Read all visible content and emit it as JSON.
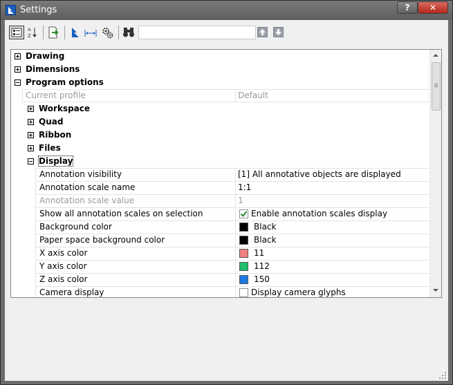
{
  "window": {
    "title": "Settings",
    "help_label": "?",
    "close_label": "✕"
  },
  "toolbar": {
    "items": [
      {
        "name": "categorized-view",
        "icon": "categorized-view-icon"
      },
      {
        "name": "alphabetical-view",
        "icon": "sort-az-icon"
      },
      {
        "name": "export",
        "icon": "export-icon"
      },
      {
        "name": "drawing-settings",
        "icon": "bricscad-icon"
      },
      {
        "name": "dimension-settings",
        "icon": "dimension-icon"
      },
      {
        "name": "program-options",
        "icon": "gears-icon"
      },
      {
        "name": "find",
        "icon": "binoculars-icon"
      }
    ],
    "search": {
      "value": "",
      "placeholder": ""
    },
    "prev_icon": "arrow-up-icon",
    "next_icon": "arrow-down-icon"
  },
  "tree": {
    "drawing": "Drawing",
    "dimensions": "Dimensions",
    "program_options": "Program options",
    "current_profile": {
      "name": "Current profile",
      "value": "Default"
    },
    "workspace": "Workspace",
    "quad": "Quad",
    "ribbon": "Ribbon",
    "files": "Files",
    "display": "Display"
  },
  "display_props": [
    {
      "name": "Annotation visibility",
      "value": "[1] All annotative objects are displayed",
      "kind": "text",
      "disabled": false
    },
    {
      "name": "Annotation scale name",
      "value": "1:1",
      "kind": "text",
      "disabled": false
    },
    {
      "name": "Annotation scale value",
      "value": "1",
      "kind": "text",
      "disabled": true
    },
    {
      "name": "Show all annotation scales on selection",
      "value": "Enable annotation scales display",
      "kind": "checkbox",
      "checked": true,
      "disabled": false
    },
    {
      "name": "Background color",
      "value": "Black",
      "kind": "color",
      "color": "#000000",
      "disabled": false
    },
    {
      "name": "Paper space background color",
      "value": "Black",
      "kind": "color",
      "color": "#000000",
      "disabled": false
    },
    {
      "name": "X axis color",
      "value": "11",
      "kind": "color",
      "color": "#f07f7f",
      "disabled": false
    },
    {
      "name": "Y axis color",
      "value": "112",
      "kind": "color",
      "color": "#1fbf6a",
      "disabled": false
    },
    {
      "name": "Z axis color",
      "value": "150",
      "kind": "color",
      "color": "#1f78e0",
      "disabled": false
    },
    {
      "name": "Camera display",
      "value": "Display camera glyphs",
      "kind": "checkbox",
      "checked": false,
      "disabled": false
    }
  ],
  "colors": {
    "titlebar": "#6a6a6a",
    "close_button": "#c5392b",
    "grid_line": "#e3e3e3",
    "disabled_text": "#9a9a9a"
  }
}
